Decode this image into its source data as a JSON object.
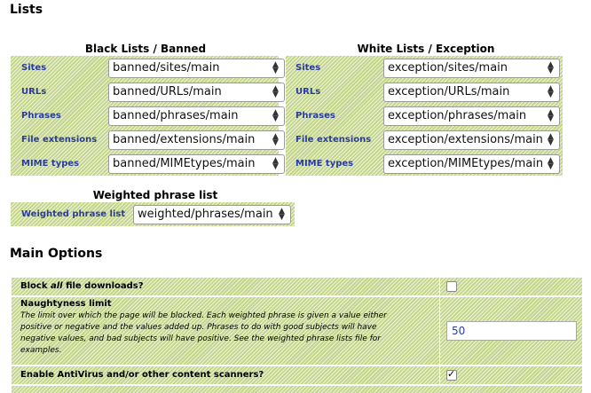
{
  "headings": {
    "lists": "Lists",
    "main_options": "Main Options"
  },
  "black": {
    "header": "Black Lists / Banned",
    "rows": [
      {
        "label": "Sites",
        "value": "banned/sites/main"
      },
      {
        "label": "URLs",
        "value": "banned/URLs/main"
      },
      {
        "label": "Phrases",
        "value": "banned/phrases/main"
      },
      {
        "label": "File extensions",
        "value": "banned/extensions/main"
      },
      {
        "label": "MIME types",
        "value": "banned/MIMEtypes/main"
      }
    ]
  },
  "white": {
    "header": "White Lists / Exception",
    "rows": [
      {
        "label": "Sites",
        "value": "exception/sites/main"
      },
      {
        "label": "URLs",
        "value": "exception/URLs/main"
      },
      {
        "label": "Phrases",
        "value": "exception/phrases/main"
      },
      {
        "label": "File extensions",
        "value": "exception/extensions/main"
      },
      {
        "label": "MIME types",
        "value": "exception/MIMEtypes/main"
      }
    ]
  },
  "weighted": {
    "header": "Weighted phrase list",
    "label": "Weighted phrase list",
    "value": "weighted/phrases/main"
  },
  "options": {
    "block_prefix": "Block ",
    "block_emph": "all",
    "block_suffix": " file downloads?",
    "block_checked": false,
    "naughty_title": "Naughtyness limit",
    "naughty_desc": "The limit over which the page will be blocked. Each weighted phrase is given a value either positive or negative and the values added up. Phrases to do with good subjects will have negative values, and bad subjects will have positive. See the weighted phrase lists file for examples.",
    "naughty_value": "50",
    "av_title": "Enable AntiVirus and/or other content scanners?",
    "av_checked": true
  }
}
